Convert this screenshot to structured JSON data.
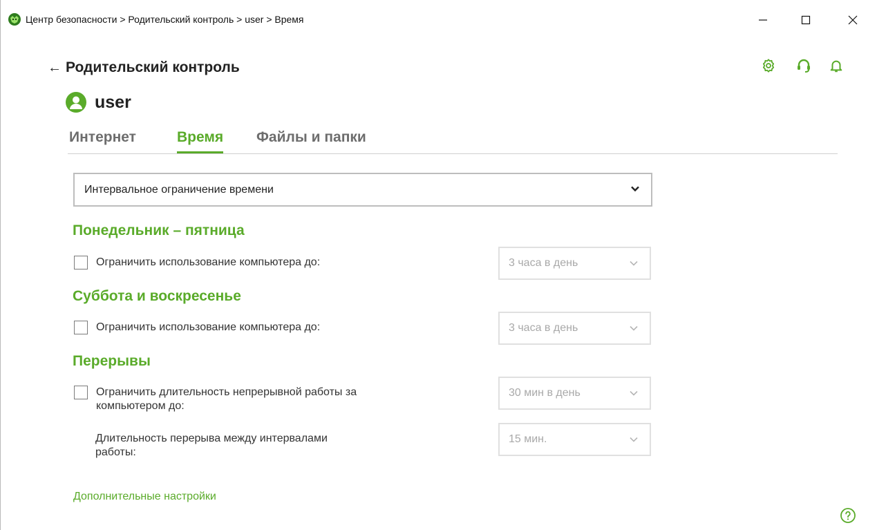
{
  "window": {
    "title": "Центр безопасности > Родительский контроль > user > Время"
  },
  "header": {
    "back_label": "Родительский контроль",
    "user_name": "user"
  },
  "tabs": [
    {
      "label": "Интернет",
      "active": false
    },
    {
      "label": "Время",
      "active": true
    },
    {
      "label": "Файлы и папки",
      "active": false
    }
  ],
  "mode": {
    "selected": "Интервальное ограничение времени"
  },
  "weekdays": {
    "title": "Понедельник – пятница",
    "checkbox_label": "Ограничить использование компьютера до:",
    "checked": false,
    "select_value": "3 часа в день"
  },
  "weekend": {
    "title": "Суббота и воскресенье",
    "checkbox_label": "Ограничить использование компьютера до:",
    "checked": false,
    "select_value": "3 часа в день"
  },
  "breaks": {
    "title": "Перерывы",
    "checkbox_label_line1": "Ограничить длительность непрерывной работы за",
    "checkbox_label_line2": "компьютером до:",
    "checked": false,
    "select_value": "30 мин в день",
    "interval_label_line1": "Длительность перерыва между интервалами",
    "interval_label_line2": "работы:",
    "interval_select_value": "15 мин."
  },
  "footer": {
    "more_settings": "Дополнительные настройки"
  },
  "colors": {
    "accent": "#5aab2a",
    "disabled_text": "#a9a9a9"
  },
  "icons": [
    "app-logo-icon",
    "minimize-icon",
    "maximize-icon",
    "close-icon",
    "back-arrow-icon",
    "settings-icon",
    "support-icon",
    "bell-icon",
    "user-avatar-icon",
    "chevron-down-icon",
    "help-icon"
  ]
}
